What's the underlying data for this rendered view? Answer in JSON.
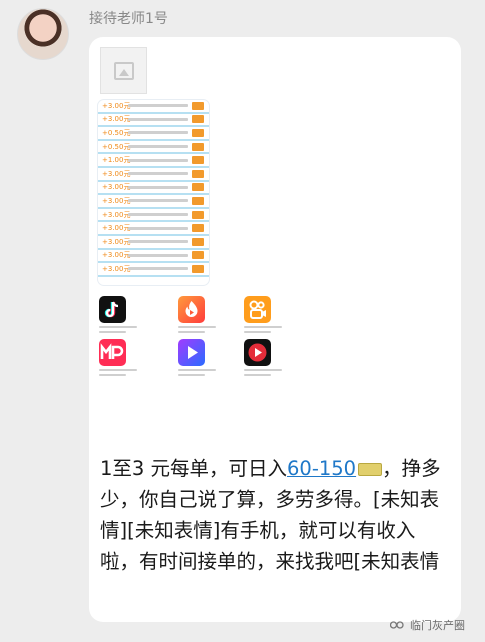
{
  "sender": {
    "name": "接待老师1号"
  },
  "task_list": {
    "prices": [
      "+3.00元",
      "+3.00元",
      "+0.50元",
      "+0.50元",
      "+1.00元",
      "+3.00元",
      "+3.00元",
      "+3.00元",
      "+3.00元",
      "+3.00元",
      "+3.00元",
      "+3.00元",
      "+3.00元"
    ]
  },
  "apps": [
    {
      "icon": "tiktok-icon"
    },
    {
      "icon": "flame-video-icon"
    },
    {
      "icon": "kuaishou-icon"
    },
    {
      "icon": "mp-icon"
    },
    {
      "icon": "play-video-icon"
    },
    {
      "icon": "red-play-icon"
    }
  ],
  "message": {
    "part1": "1至3 元每单，可日入",
    "link": "60-150",
    "part2": "，挣多少，你自己说了算，多劳多得。[未知表情][未知表情]有手机，就可以有收入啦，有时间接单的，来找我吧[未知表情"
  },
  "watermark": {
    "text": "临门灰产圈"
  }
}
